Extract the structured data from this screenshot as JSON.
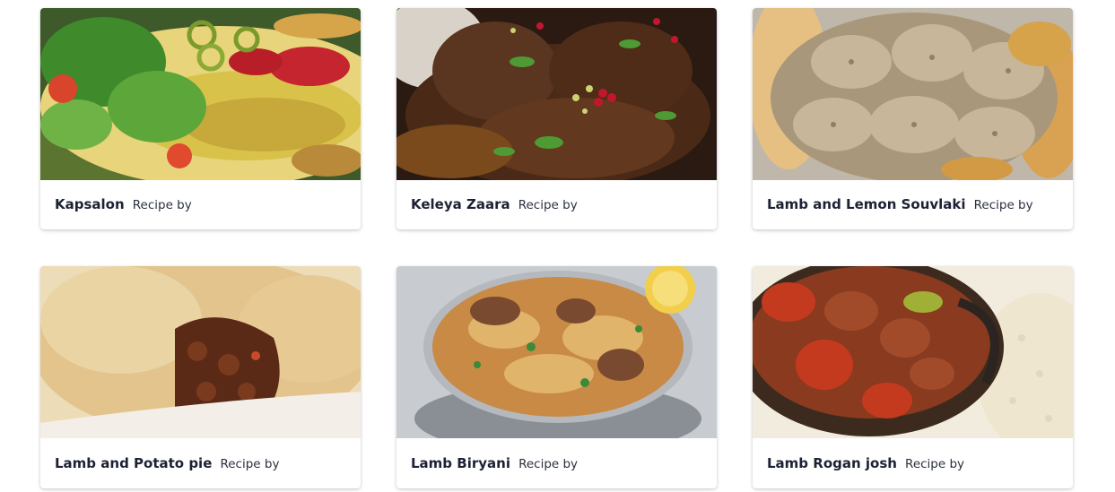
{
  "recipes": [
    {
      "name": "Kapsalon",
      "by_label": "Recipe by",
      "image_icon": "kapsalon-photo"
    },
    {
      "name": "Keleya Zaara",
      "by_label": "Recipe by",
      "image_icon": "keleya-zaara-photo"
    },
    {
      "name": "Lamb and Lemon Souvlaki",
      "by_label": "Recipe by",
      "image_icon": "souvlaki-photo"
    },
    {
      "name": "Lamb and Potato pie",
      "by_label": "Recipe by",
      "image_icon": "potato-pie-photo"
    },
    {
      "name": "Lamb Biryani",
      "by_label": "Recipe by",
      "image_icon": "biryani-photo"
    },
    {
      "name": "Lamb Rogan josh",
      "by_label": "Recipe by",
      "image_icon": "rogan-josh-photo"
    }
  ],
  "colors": {
    "card_bg": "#ffffff",
    "title_text": "#1c2233",
    "caption_text": "#2b3140"
  }
}
